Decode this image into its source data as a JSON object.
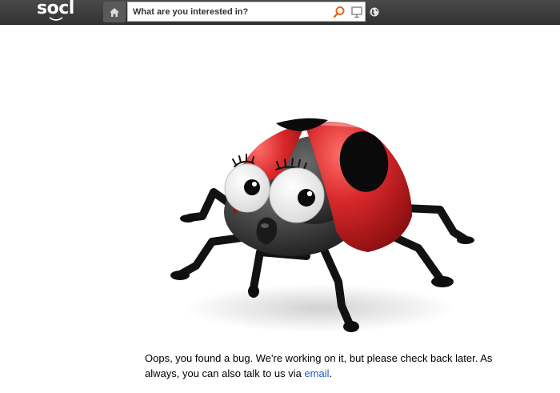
{
  "header": {
    "logo_text": "socl",
    "search_placeholder": "What are you interested in?",
    "icons": {
      "home": "home-icon",
      "search": "search-icon",
      "present": "presentation-icon",
      "globe": "globe-icon"
    },
    "colors": {
      "bar": "#3c3c3c",
      "search_icon": "#e8621c"
    }
  },
  "error": {
    "message": "Oops, you found a bug. We're working on it, but please check back later. As always, you can also talk to us via ",
    "link_label": "email",
    "end": "."
  },
  "colors": {
    "link": "#1f5fbf",
    "ladybug_shell": "#d8282a"
  }
}
